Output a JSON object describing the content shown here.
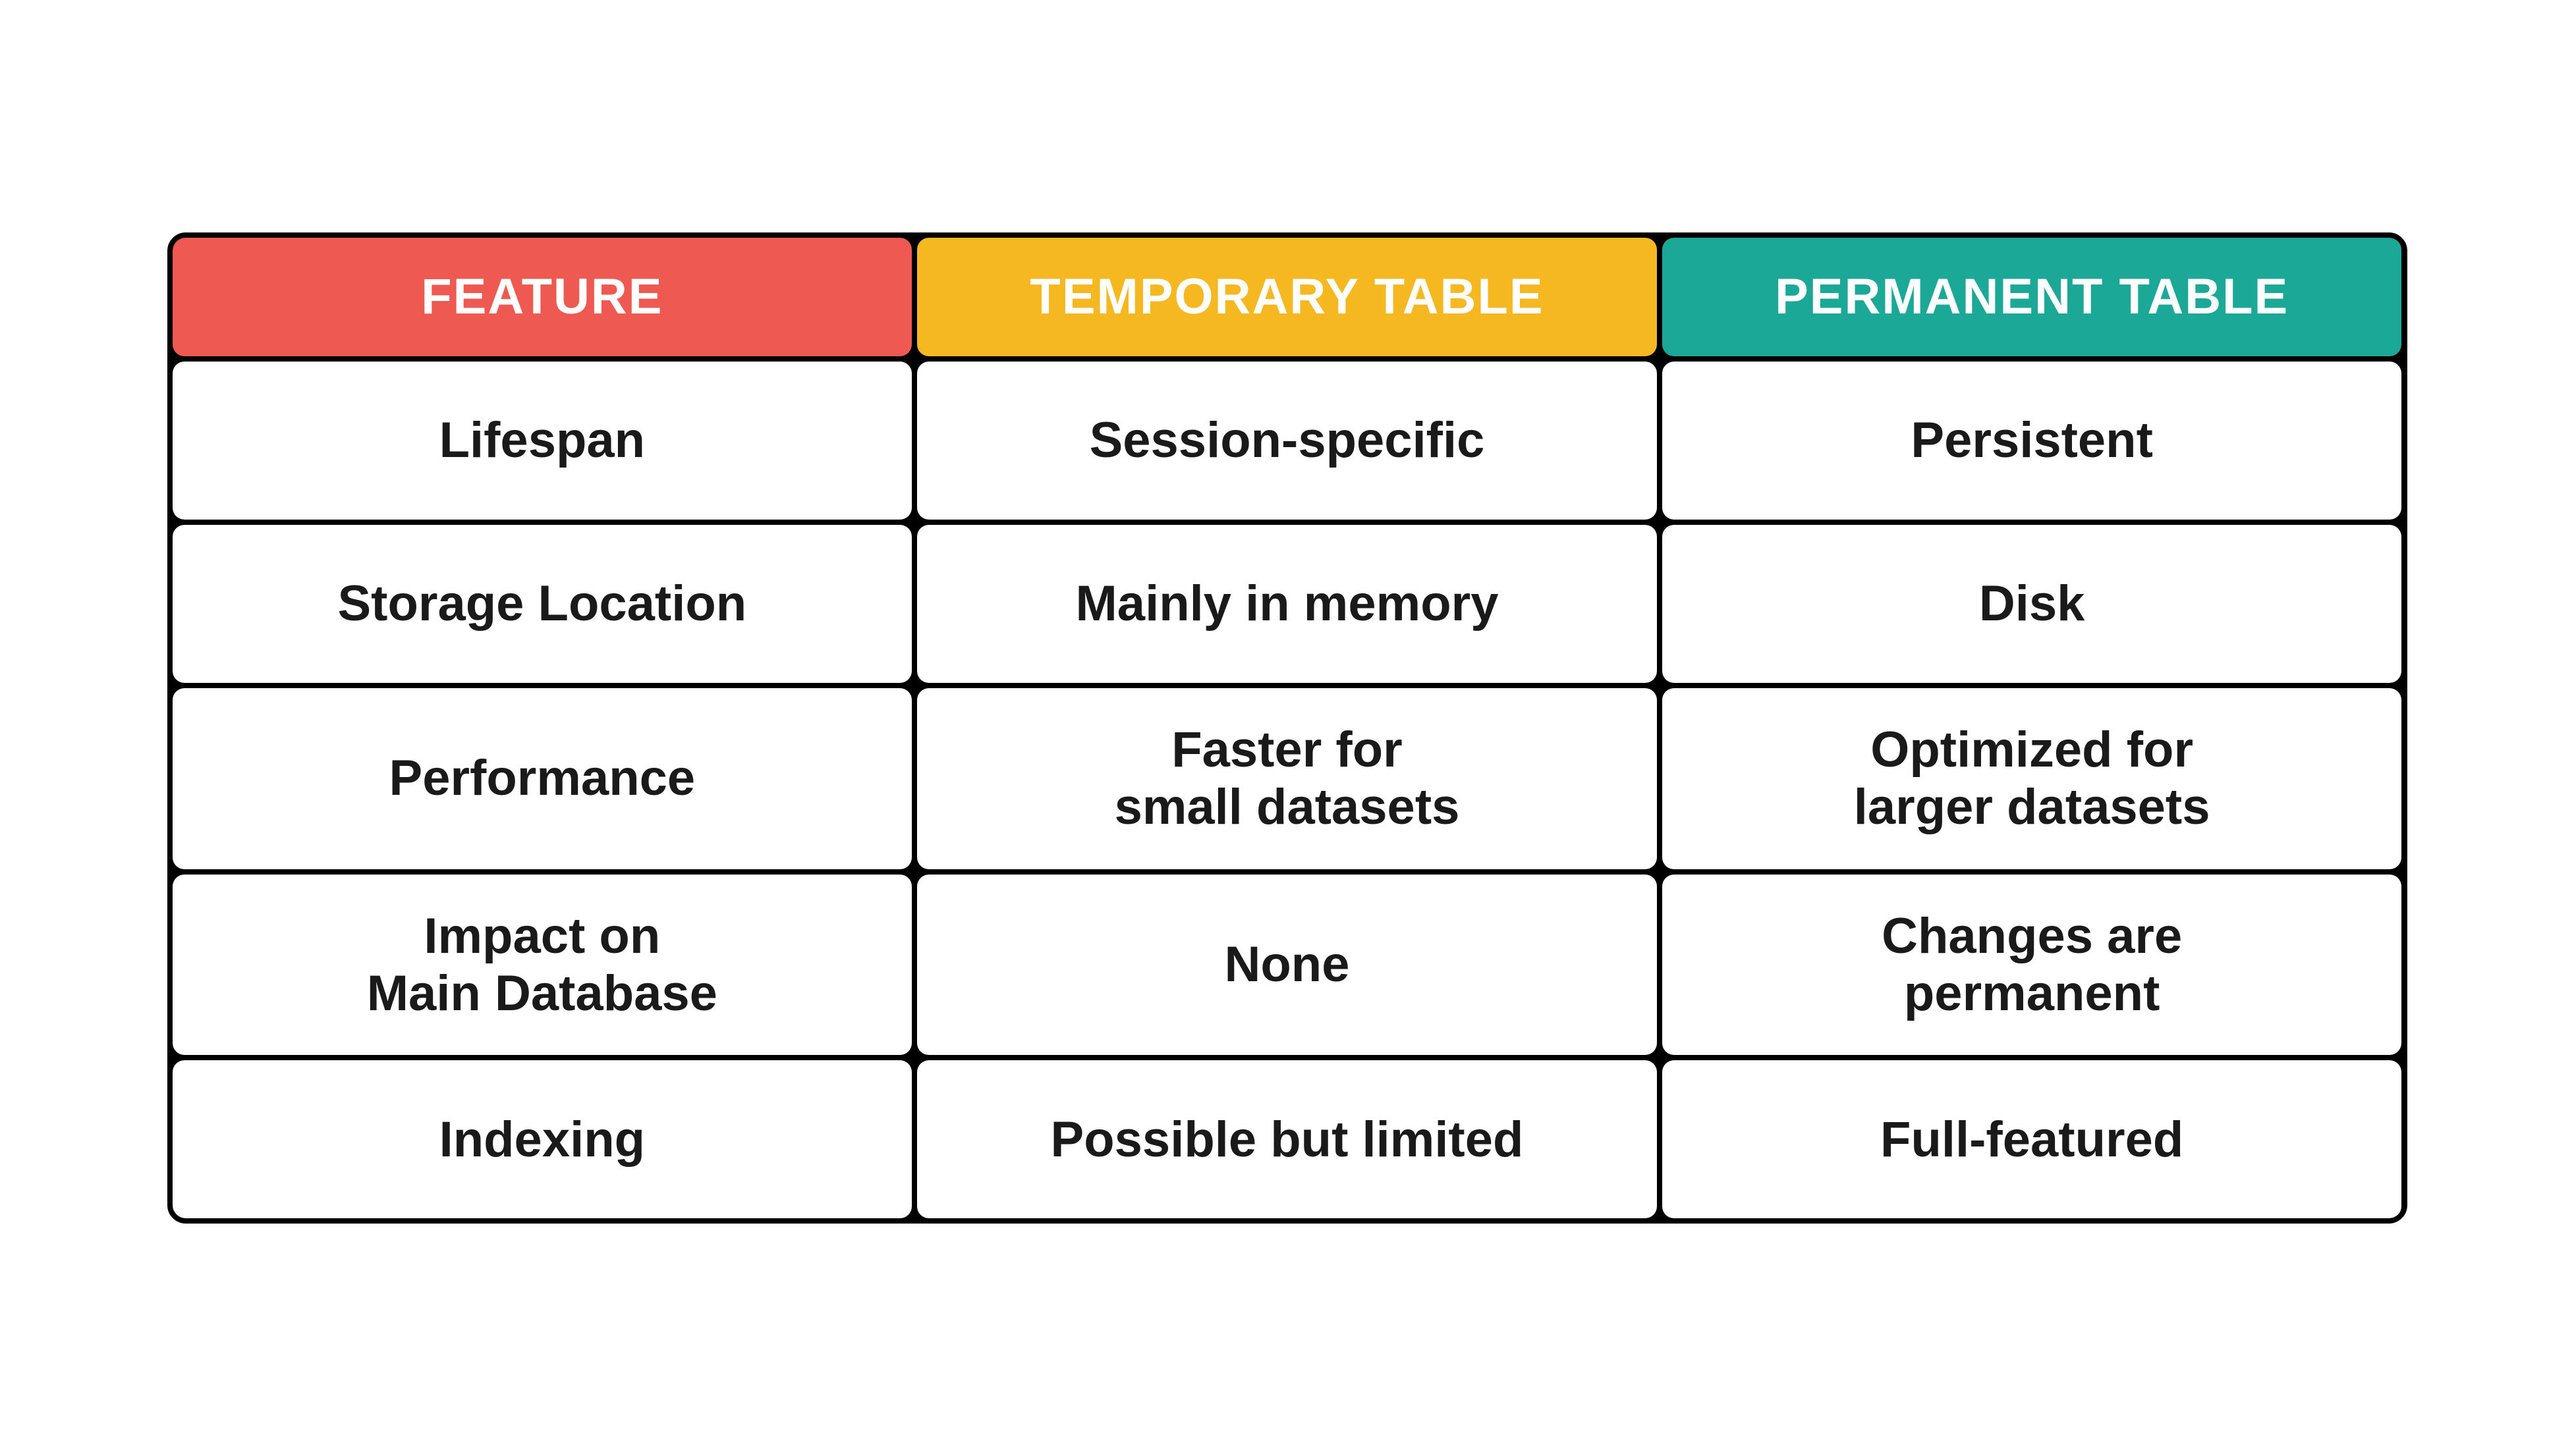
{
  "table": {
    "headers": {
      "feature": "FEATURE",
      "temporary": "TEMPORARY TABLE",
      "permanent": "PERMANENT TABLE"
    },
    "rows": [
      {
        "feature": "Lifespan",
        "temporary": "Session-specific",
        "permanent": "Persistent"
      },
      {
        "feature": "Storage Location",
        "temporary": "Mainly in memory",
        "permanent": "Disk"
      },
      {
        "feature": "Performance",
        "temporary": "Faster for\nsmall datasets",
        "permanent": "Optimized for\nlarger datasets"
      },
      {
        "feature": "Impact on\nMain Database",
        "temporary": "None",
        "permanent": "Changes are\npermanent"
      },
      {
        "feature": "Indexing",
        "temporary": "Possible but limited",
        "permanent": "Full-featured"
      }
    ]
  },
  "colors": {
    "feature_header": "#ee5a52",
    "temporary_header": "#f5b821",
    "permanent_header": "#1ba896"
  }
}
